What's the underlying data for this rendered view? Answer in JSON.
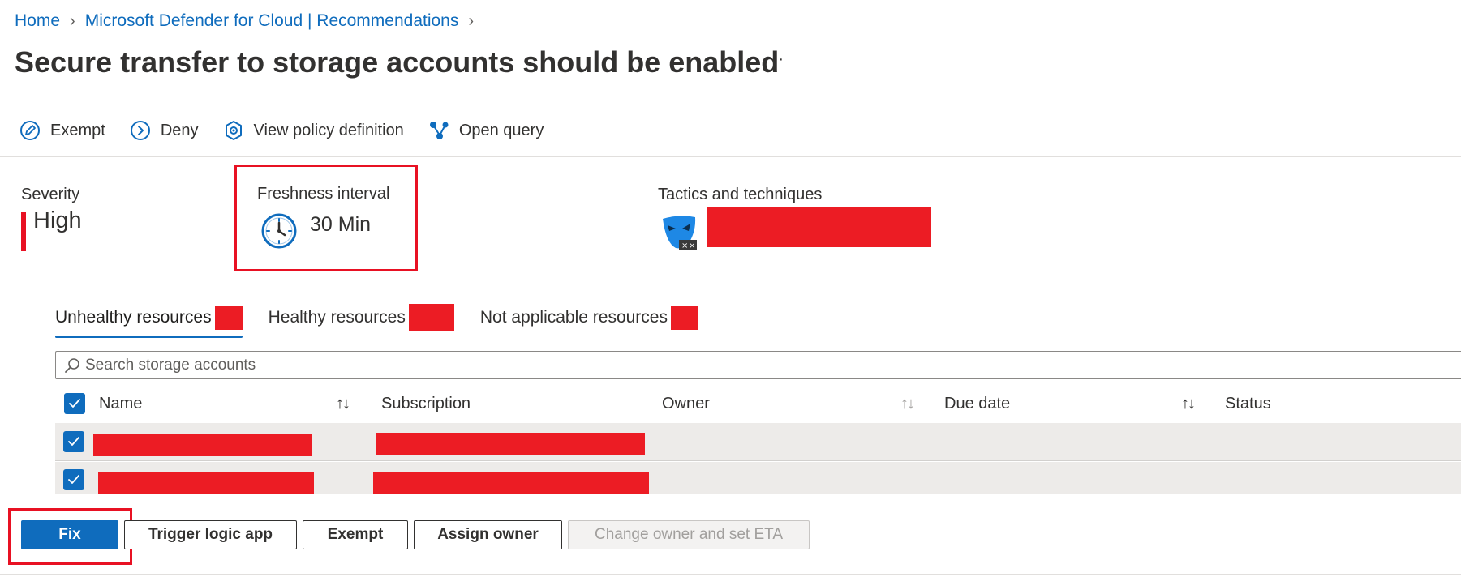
{
  "breadcrumb": {
    "items": [
      "Home",
      "Microsoft Defender for Cloud | Recommendations"
    ]
  },
  "page": {
    "title": "Secure transfer to storage accounts should be enabled",
    "more_label": "···"
  },
  "toolbar": {
    "exempt": "Exempt",
    "deny": "Deny",
    "view_policy": "View policy definition",
    "open_query": "Open query"
  },
  "essentials": {
    "severity_label": "Severity",
    "severity_value": "High",
    "freshness_label": "Freshness interval",
    "freshness_value": "30 Min",
    "tactics_label": "Tactics and techniques"
  },
  "tabs": [
    {
      "label": "Unhealthy resources",
      "active": true
    },
    {
      "label": "Healthy resources",
      "active": false
    },
    {
      "label": "Not applicable resources",
      "active": false
    }
  ],
  "search": {
    "placeholder": "Search storage accounts"
  },
  "table": {
    "columns": [
      "Name",
      "Subscription",
      "Owner",
      "Due date",
      "Status"
    ],
    "rows": [
      {
        "selected": true
      },
      {
        "selected": true
      }
    ]
  },
  "actions": {
    "fix": "Fix",
    "trigger_logic_app": "Trigger logic app",
    "exempt": "Exempt",
    "assign_owner": "Assign owner",
    "change_owner_eta": "Change owner and set ETA"
  },
  "colors": {
    "accent": "#0f6cbd",
    "severity_high": "#e81123",
    "redaction": "#ec1c24"
  }
}
